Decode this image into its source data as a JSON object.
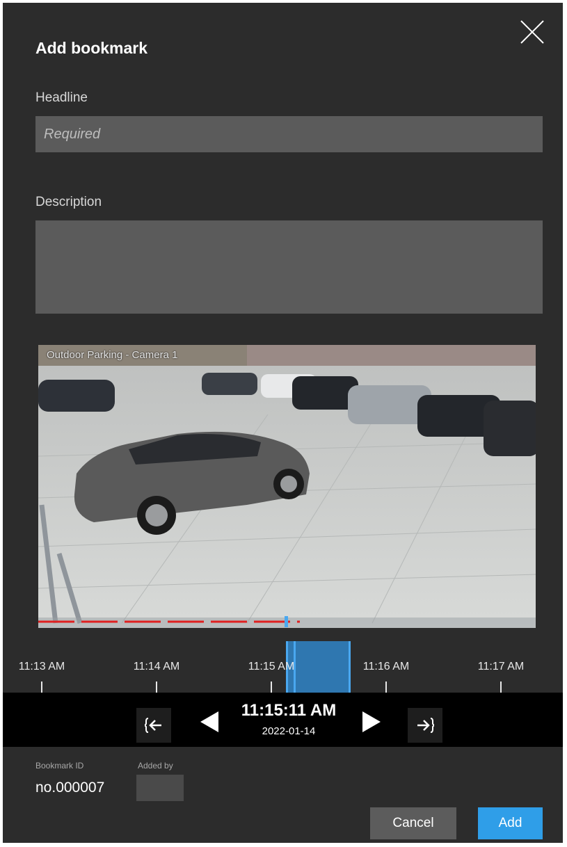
{
  "dialog": {
    "title": "Add bookmark",
    "close_icon": "close-icon",
    "headline": {
      "label": "Headline",
      "placeholder": "Required",
      "value": ""
    },
    "description": {
      "label": "Description",
      "value": ""
    }
  },
  "video": {
    "camera_label": "Outdoor Parking - Camera 1",
    "recording_color": "#e02020"
  },
  "timeline": {
    "ticks": [
      "11:13 AM",
      "11:14 AM",
      "11:15 AM",
      "11:16 AM",
      "11:17 AM"
    ],
    "selection_color": "#2f77b0"
  },
  "controls": {
    "go_start_icon": "go-to-start-icon",
    "go_end_icon": "go-to-end-icon",
    "prev_icon": "step-back-icon",
    "next_icon": "step-forward-icon",
    "time": "11:15:11 AM",
    "date": "2022-01-14"
  },
  "meta": {
    "bookmark_id_label": "Bookmark ID",
    "bookmark_id": "no.000007",
    "added_by_label": "Added by"
  },
  "buttons": {
    "cancel": "Cancel",
    "add": "Add"
  },
  "colors": {
    "accent": "#2f9ee8",
    "background": "#2c2c2c",
    "field": "#5b5b5b"
  }
}
